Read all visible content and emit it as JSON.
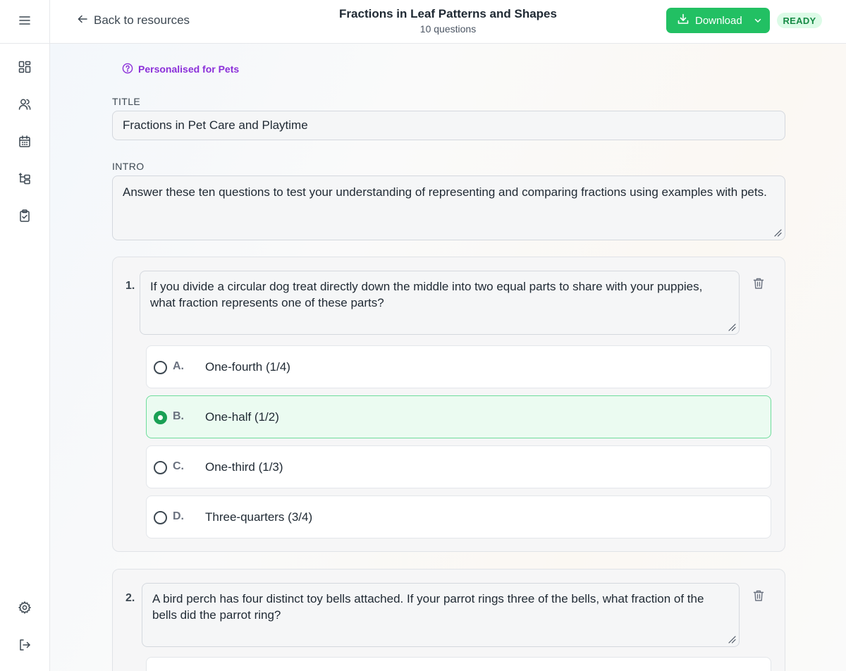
{
  "sidebar": {
    "items": [
      {
        "name": "menu-icon"
      },
      {
        "name": "dashboard-icon"
      },
      {
        "name": "users-icon"
      },
      {
        "name": "calendar-icon"
      },
      {
        "name": "hierarchy-icon"
      },
      {
        "name": "clipboard-check-icon"
      },
      {
        "name": "settings-icon"
      },
      {
        "name": "logout-icon"
      }
    ]
  },
  "header": {
    "back_label": "Back to resources",
    "title": "Fractions in Leaf Patterns and Shapes",
    "subtitle": "10 questions",
    "download_label": "Download",
    "status": "READY"
  },
  "colors": {
    "accent_green": "#22c063",
    "personalised_purple": "#8b2fd9",
    "status_bg": "#dcfbe7",
    "status_text": "#168a45"
  },
  "form": {
    "personalised_label": "Personalised for Pets",
    "title_label": "TITLE",
    "title_value": "Fractions in Pet Care and Playtime",
    "intro_label": "INTRO",
    "intro_value": "Answer these ten questions to test your understanding of representing and comparing fractions using examples with pets."
  },
  "questions": [
    {
      "number": "1.",
      "text": "If you divide a circular dog treat directly down the middle into two equal parts to share with your puppies, what fraction represents one of these parts?",
      "options": [
        {
          "letter": "A.",
          "text": "One-fourth (1/4)",
          "selected": false
        },
        {
          "letter": "B.",
          "text": "One-half (1/2)",
          "selected": true
        },
        {
          "letter": "C.",
          "text": "One-third (1/3)",
          "selected": false
        },
        {
          "letter": "D.",
          "text": "Three-quarters (3/4)",
          "selected": false
        }
      ]
    },
    {
      "number": "2.",
      "text": "A bird perch has four distinct toy bells attached. If your parrot rings three of the bells, what fraction of the bells did the parrot ring?",
      "options": []
    }
  ]
}
